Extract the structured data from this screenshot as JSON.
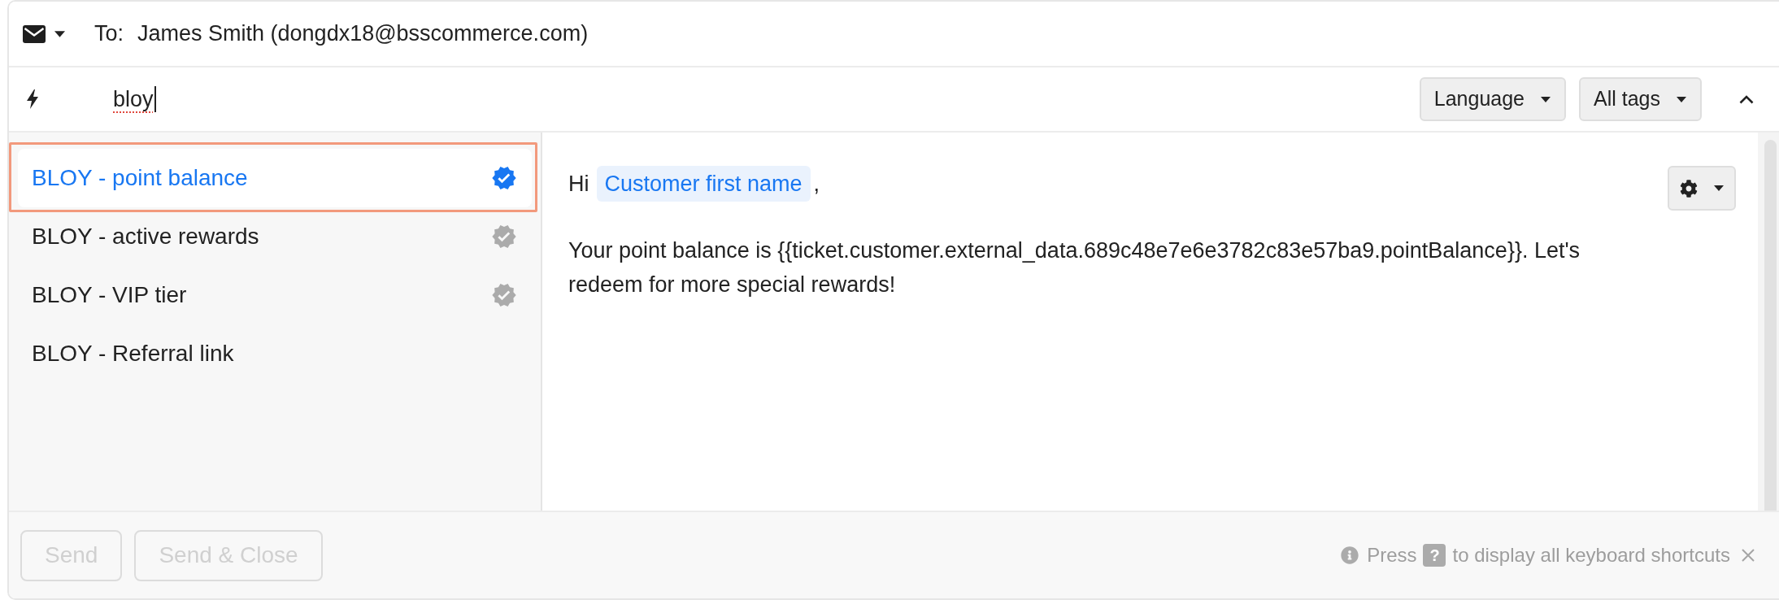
{
  "recipient": {
    "label": "To:",
    "value": "James Smith (dongdx18@bsscommerce.com)"
  },
  "search": {
    "value": "bloy",
    "misspelled": true
  },
  "filters": [
    {
      "label": "Language"
    },
    {
      "label": "All tags"
    }
  ],
  "templates": [
    {
      "title": "BLOY - point balance",
      "selected": true,
      "verified": true
    },
    {
      "title": "BLOY - active rewards",
      "selected": false,
      "verified": true
    },
    {
      "title": "BLOY - VIP tier",
      "selected": false,
      "verified": true
    },
    {
      "title": "BLOY - Referral link",
      "selected": false,
      "verified": false
    }
  ],
  "editor": {
    "greeting": "Hi",
    "variable": "Customer first name",
    "after_variable": ",",
    "body": "Your point balance is {{ticket.customer.external_data.689c48e7e6e3782c83e57ba9.pointBalance}}. Let's redeem for more special rewards!"
  },
  "actions": [
    {
      "label": "Send",
      "disabled": true
    },
    {
      "label": "Send & Close",
      "disabled": true
    }
  ],
  "hint": {
    "before": "Press",
    "key": "?",
    "after": "to display all keyboard shortcuts"
  }
}
